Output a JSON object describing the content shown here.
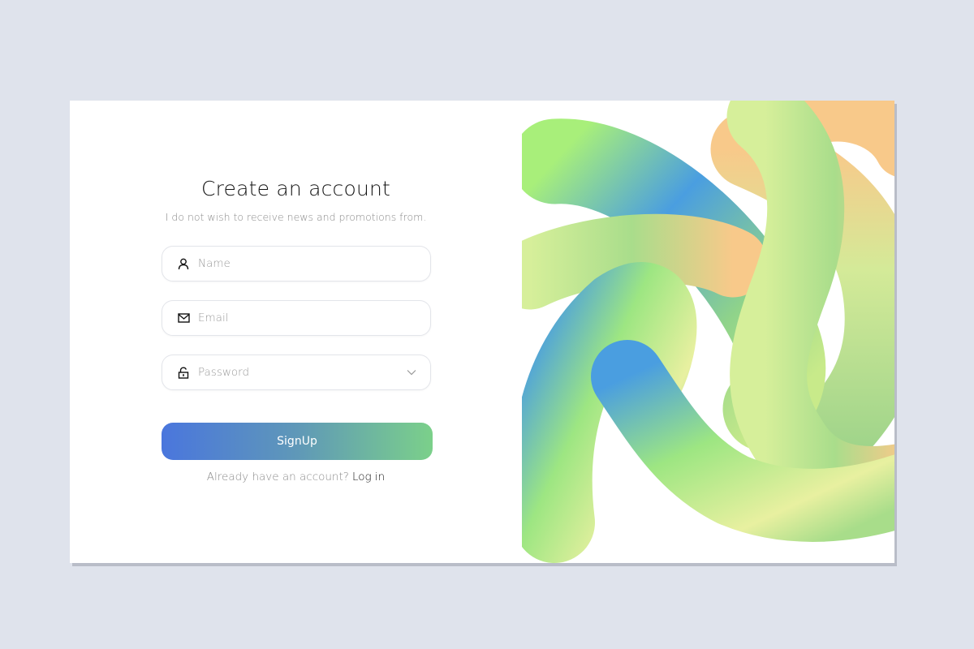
{
  "form": {
    "title": "Create an account",
    "subtitle": "I do not wish to receive news and promotions from.",
    "name_placeholder": "Name",
    "email_placeholder": "Email",
    "password_placeholder": "Password",
    "signup_label": "SignUp",
    "login_prompt": "Already have an account?",
    "login_link": "Log in"
  },
  "icons": {
    "name": "user-icon",
    "email": "mail-icon",
    "password": "lock-icon",
    "dropdown": "chevron-down-icon"
  },
  "colors": {
    "background": "#dfe3ec",
    "card": "#ffffff",
    "button_gradient_start": "#4a76dd",
    "button_gradient_end": "#7bd08a",
    "art_green": "#a8ef7a",
    "art_blue": "#4a9ee0",
    "art_peach": "#f8c98a"
  }
}
